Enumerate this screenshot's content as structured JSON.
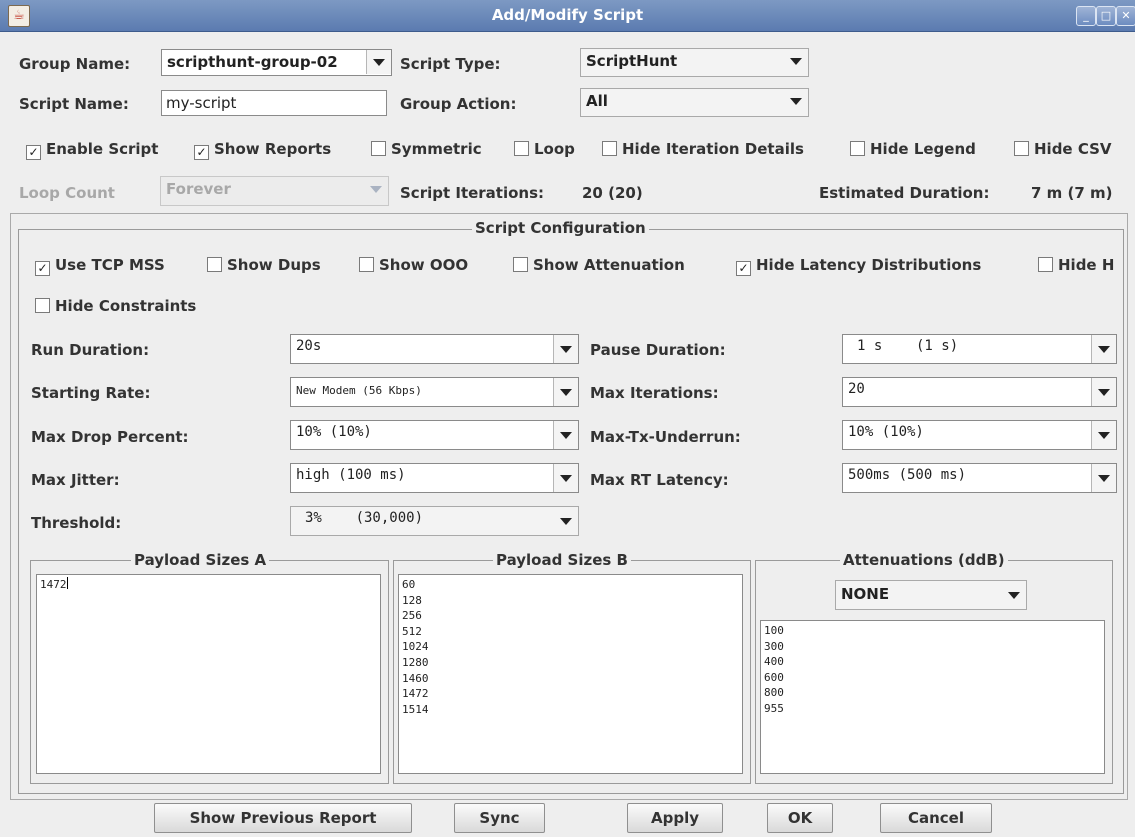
{
  "window": {
    "title": "Add/Modify Script"
  },
  "top": {
    "group_name_label": "Group Name:",
    "group_name_value": "scripthunt-group-02",
    "script_type_label": "Script Type:",
    "script_type_value": "ScriptHunt",
    "script_name_label": "Script Name:",
    "script_name_value": "my-script",
    "group_action_label": "Group Action:",
    "group_action_value": "All",
    "checkboxes": [
      {
        "label": "Enable Script",
        "checked": true
      },
      {
        "label": "Show Reports",
        "checked": true
      },
      {
        "label": "Symmetric",
        "checked": false
      },
      {
        "label": "Loop",
        "checked": false
      },
      {
        "label": "Hide Iteration Details",
        "checked": false
      },
      {
        "label": "Hide Legend",
        "checked": false
      },
      {
        "label": "Hide CSV",
        "checked": false
      }
    ],
    "loop_count_label": "Loop Count",
    "loop_count_value": "Forever",
    "script_iterations_label": "Script Iterations:",
    "script_iterations_value": "20 (20)",
    "estimated_duration_label": "Estimated Duration:",
    "estimated_duration_value": "7 m (7 m)"
  },
  "config": {
    "title": "Script Configuration",
    "checkboxes": [
      {
        "label": "Use TCP MSS",
        "checked": true
      },
      {
        "label": "Show Dups",
        "checked": false
      },
      {
        "label": "Show OOO",
        "checked": false
      },
      {
        "label": "Show Attenuation",
        "checked": false
      },
      {
        "label": "Hide Latency Distributions",
        "checked": true
      },
      {
        "label": "Hide H",
        "checked": false
      },
      {
        "label": "Hide Constraints",
        "checked": false
      }
    ],
    "fields": {
      "run_duration_label": "Run Duration:",
      "run_duration_value": "20s",
      "pause_duration_label": "Pause Duration:",
      "pause_duration_value": "1 s    (1 s)",
      "starting_rate_label": "Starting Rate:",
      "starting_rate_value": "New Modem (56 Kbps)",
      "max_iterations_label": "Max Iterations:",
      "max_iterations_value": "20",
      "max_drop_label": "Max Drop Percent:",
      "max_drop_value": "10% (10%)",
      "max_tx_underrun_label": "Max-Tx-Underrun:",
      "max_tx_underrun_value": "10% (10%)",
      "max_jitter_label": "Max Jitter:",
      "max_jitter_value": "high (100 ms)",
      "max_rt_latency_label": "Max RT Latency:",
      "max_rt_latency_value": "500ms (500 ms)",
      "threshold_label": "Threshold:",
      "threshold_value": "3%    (30,000)"
    },
    "payload_a": {
      "title": "Payload Sizes A",
      "text": "1472"
    },
    "payload_b": {
      "title": "Payload Sizes B",
      "text": "60\n128\n256\n512\n1024\n1280\n1460\n1472\n1514"
    },
    "attenuations": {
      "title": "Attenuations (ddB)",
      "select_value": "NONE",
      "text": "100\n300\n400\n600\n800\n955"
    }
  },
  "buttons": {
    "show_previous_report": "Show Previous Report",
    "sync": "Sync",
    "apply": "Apply",
    "ok": "OK",
    "cancel": "Cancel"
  }
}
